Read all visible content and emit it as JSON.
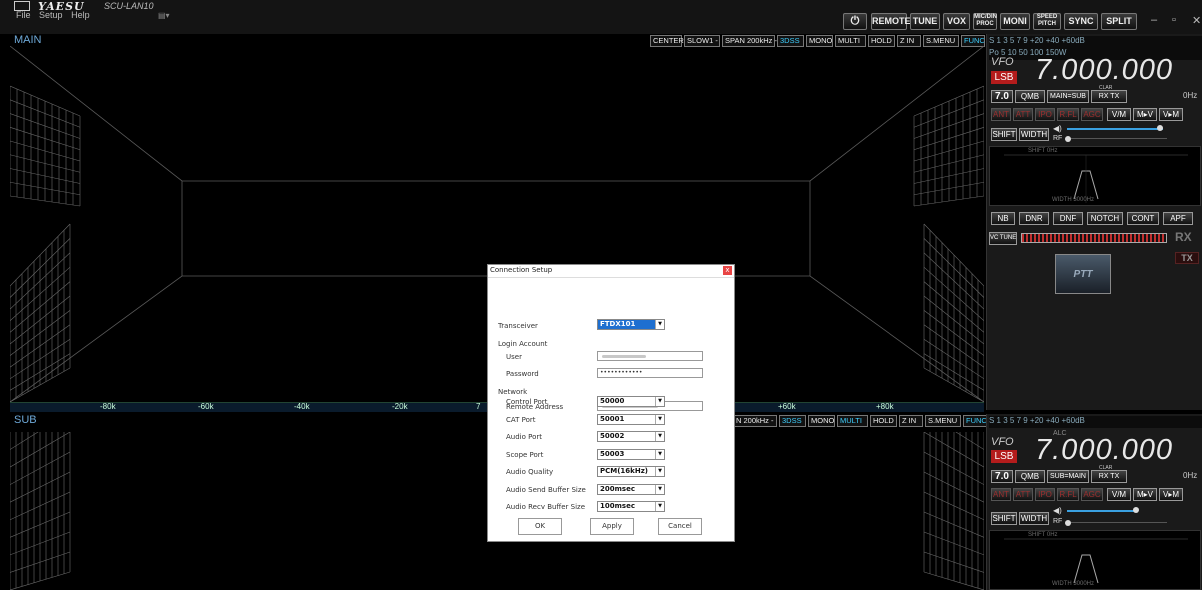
{
  "app": {
    "brand": "YAESU",
    "name": "SCU-LAN10",
    "menu": [
      "File",
      "Setup",
      "Help"
    ]
  },
  "toolbar": {
    "power_symbol": "⏻",
    "buttons": [
      "REMOTE",
      "TUNE",
      "VOX",
      "MIC/DIN PROC",
      "MONI",
      "SPEED PITCH",
      "SYNC",
      "SPLIT"
    ],
    "minimize": "–",
    "maximize": "▫",
    "close": "✕"
  },
  "main_scope": {
    "label": "MAIN",
    "controls": [
      {
        "label": "CENTER",
        "on": false
      },
      {
        "label": "SLOW1 -",
        "on": false
      },
      {
        "label": "SPAN 200kHz -",
        "on": false
      },
      {
        "label": "3DSS",
        "on": true
      },
      {
        "label": "MONO",
        "on": false
      },
      {
        "label": "MULTI",
        "on": false
      },
      {
        "label": "HOLD",
        "on": false
      },
      {
        "label": "Z IN",
        "on": false
      },
      {
        "label": "S.MENU",
        "on": false
      },
      {
        "label": "FUNC",
        "on": true
      }
    ]
  },
  "sub_scope": {
    "label": "SUB",
    "controls": [
      {
        "label": "N 200kHz -",
        "on": false
      },
      {
        "label": "3DSS",
        "on": true
      },
      {
        "label": "MONO",
        "on": false
      },
      {
        "label": "MULTI",
        "on": true
      },
      {
        "label": "HOLD",
        "on": false
      },
      {
        "label": "Z IN",
        "on": false
      },
      {
        "label": "S.MENU",
        "on": false
      },
      {
        "label": "FUNC",
        "on": true
      }
    ]
  },
  "freq_axis": {
    "ticks": [
      "-80k",
      "-60k",
      "-40k",
      "-20k",
      "+60k",
      "+80k"
    ],
    "partial": "7"
  },
  "main_panel": {
    "meter": "S  1  3  5  7  9  +20  +40  +60dB",
    "po_meter": "Po 5      10      50      100     150W",
    "vfo": "VFO",
    "mode": "LSB",
    "frequency": "7.000.000",
    "band": "7.0",
    "qmb": "QMB",
    "swap": "MAIN=SUB",
    "clar": "CLAR",
    "rxtx": "RX TX",
    "clar_offset": "0Hz",
    "dim_buttons": [
      "ANT",
      "ATT",
      "IPO",
      "R.FL",
      "AGC"
    ],
    "vfo_buttons": [
      "V/M",
      "M▸V",
      "V▸M"
    ],
    "shift": "SHIFT",
    "width": "WIDTH",
    "rf_label": "RF",
    "shift_readout": "SHIFT  0Hz",
    "width_readout": "WIDTH  3000Hz",
    "dsp_buttons": [
      "NB",
      "DNR",
      "DNF",
      "NOTCH",
      "CONT",
      "APF"
    ],
    "vc_tune": "VC TUNE",
    "rx": "RX",
    "tx": "TX",
    "ptt": "PTT"
  },
  "sub_panel": {
    "meter": "S  1  3  5  7  9  +20  +40  +60dB",
    "alc": "ALC",
    "vfo": "VFO",
    "mode": "LSB",
    "frequency": "7.000.000",
    "band": "7.0",
    "qmb": "QMB",
    "swap": "SUB=MAIN",
    "clar": "CLAR",
    "rxtx": "RX TX",
    "clar_offset": "0Hz",
    "dim_buttons": [
      "ANT",
      "ATT",
      "IPO",
      "R.FL",
      "AGC"
    ],
    "vfo_buttons": [
      "V/M",
      "M▸V",
      "V▸M"
    ],
    "shift": "SHIFT",
    "width": "WIDTH",
    "rf_label": "RF",
    "shift_readout": "SHIFT  0Hz",
    "width_readout": "WIDTH  3000Hz"
  },
  "dialog": {
    "title": "Connection Setup",
    "close": "x",
    "transceiver_label": "Transceiver",
    "transceiver_value": "FTDX101",
    "login_section": "Login Account",
    "user_label": "User",
    "password_label": "Password",
    "password_value": "••••••••••••",
    "network_section": "Network",
    "remote_label": "Remote Address",
    "fields": [
      {
        "label": "Control Port",
        "value": "50000"
      },
      {
        "label": "CAT Port",
        "value": "50001"
      },
      {
        "label": "Audio Port",
        "value": "50002"
      },
      {
        "label": "Scope Port",
        "value": "50003"
      },
      {
        "label": "Audio Quality",
        "value": "PCM(16kHz)"
      },
      {
        "label": "Audio Send Buffer Size",
        "value": "200msec"
      },
      {
        "label": "Audio Recv Buffer Size",
        "value": "100msec"
      }
    ],
    "ok": "OK",
    "apply": "Apply",
    "cancel": "Cancel"
  }
}
